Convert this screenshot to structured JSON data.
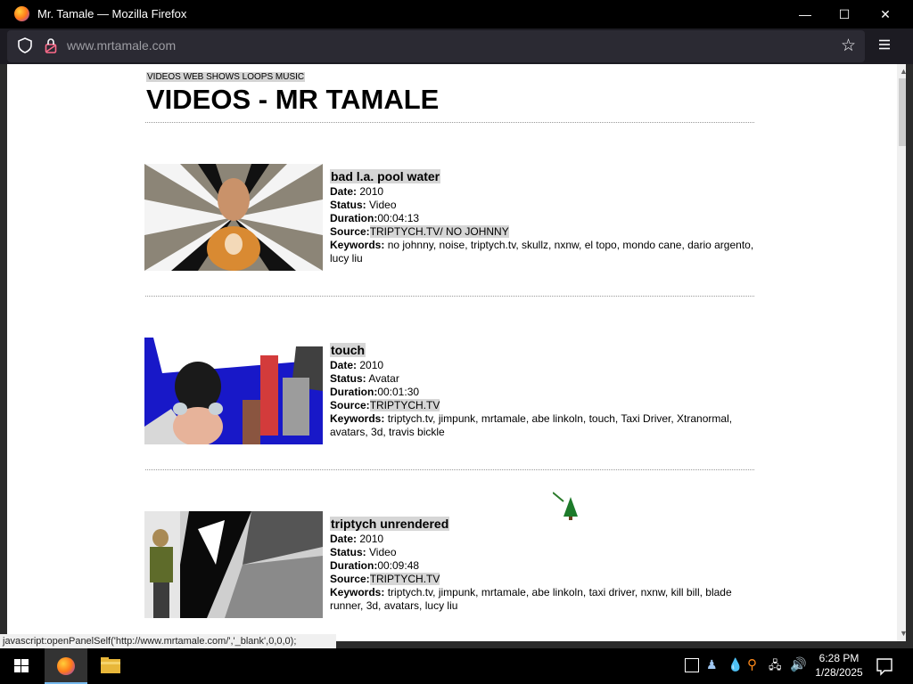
{
  "window": {
    "title": "Mr. Tamale — Mozilla Firefox",
    "minimize": "—",
    "maximize": "☐",
    "close": "✕"
  },
  "browser": {
    "url": "www.mrtamale.com",
    "status_tip": "javascript:openPanelSelf('http://www.mrtamale.com/','_blank',0,0,0);"
  },
  "site": {
    "nav": "VIDEOS WEB SHOWS LOOPS MUSIC",
    "title": "VIDEOS - MR TAMALE"
  },
  "labels": {
    "date": "Date:",
    "status": "Status:",
    "duration": "Duration:",
    "source": "Source:",
    "keywords": "Keywords:"
  },
  "entries": [
    {
      "title": "bad l.a. pool water",
      "date": "2010",
      "status": "Video",
      "duration": "00:04:13",
      "source": "TRIPTYCH.TV/ NO JOHNNY",
      "keywords": "no johnny, noise, triptych.tv, skullz, nxnw, el topo, mondo cane, dario argento, lucy liu"
    },
    {
      "title": "touch",
      "date": "2010",
      "status": "Avatar",
      "duration": "00:01:30",
      "source": "TRIPTYCH.TV",
      "keywords": "triptych.tv, jimpunk, mrtamale, abe linkoln, touch, Taxi Driver, Xtranormal, avatars, 3d, travis bickle"
    },
    {
      "title": "triptych unrendered",
      "date": "2010",
      "status": "Video",
      "duration": "00:09:48",
      "source": "TRIPTYCH.TV",
      "keywords": "triptych.tv, jimpunk, mrtamale, abe linkoln, taxi driver, nxnw, kill bill, blade runner, 3d, avatars, lucy liu"
    }
  ],
  "taskbar": {
    "time": "6:28 PM",
    "date": "1/28/2025"
  }
}
